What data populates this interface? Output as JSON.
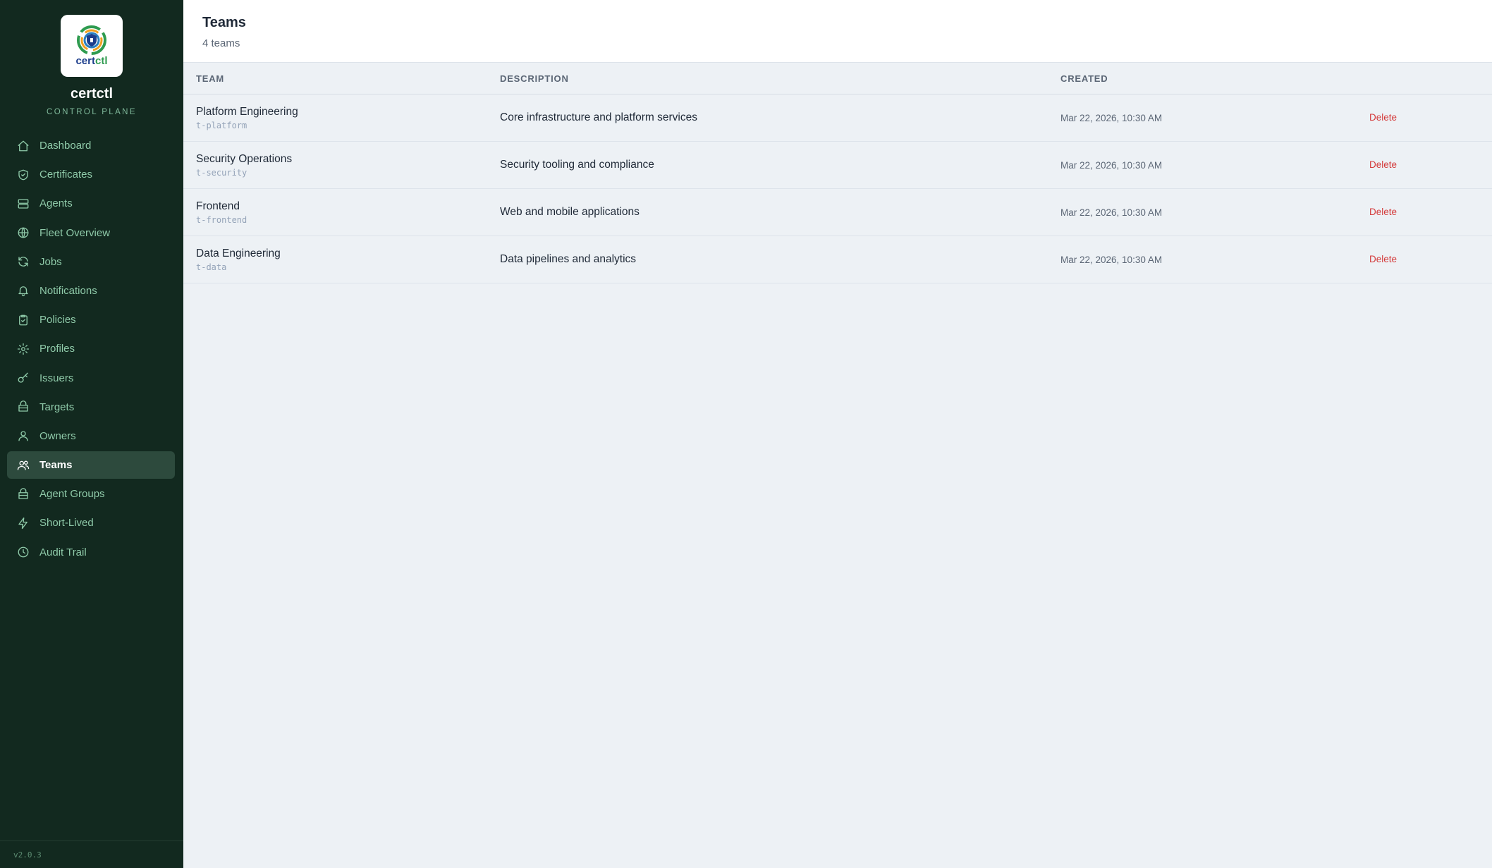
{
  "sidebar": {
    "logo_text_cert": "cert",
    "logo_text_ctl": "ctl",
    "brand_name": "certctl",
    "brand_subtitle": "CONTROL PLANE",
    "items": [
      {
        "label": "Dashboard",
        "icon": "home-icon"
      },
      {
        "label": "Certificates",
        "icon": "shield-icon"
      },
      {
        "label": "Agents",
        "icon": "server-icon"
      },
      {
        "label": "Fleet Overview",
        "icon": "globe-icon"
      },
      {
        "label": "Jobs",
        "icon": "refresh-icon"
      },
      {
        "label": "Notifications",
        "icon": "bell-icon"
      },
      {
        "label": "Policies",
        "icon": "clipboard-check-icon"
      },
      {
        "label": "Profiles",
        "icon": "gear-icon"
      },
      {
        "label": "Issuers",
        "icon": "key-icon"
      },
      {
        "label": "Targets",
        "icon": "box-icon"
      },
      {
        "label": "Owners",
        "icon": "user-icon"
      },
      {
        "label": "Teams",
        "icon": "users-icon",
        "active": true
      },
      {
        "label": "Agent Groups",
        "icon": "box-icon"
      },
      {
        "label": "Short-Lived",
        "icon": "bolt-icon"
      },
      {
        "label": "Audit Trail",
        "icon": "clock-icon"
      }
    ],
    "version": "v2.0.3"
  },
  "header": {
    "title": "Teams",
    "count": "4 teams"
  },
  "table": {
    "columns": [
      "TEAM",
      "DESCRIPTION",
      "CREATED",
      ""
    ],
    "rows": [
      {
        "name": "Platform Engineering",
        "id": "t-platform",
        "description": "Core infrastructure and platform services",
        "created": "Mar 22, 2026, 10:30 AM",
        "action": "Delete"
      },
      {
        "name": "Security Operations",
        "id": "t-security",
        "description": "Security tooling and compliance",
        "created": "Mar 22, 2026, 10:30 AM",
        "action": "Delete"
      },
      {
        "name": "Frontend",
        "id": "t-frontend",
        "description": "Web and mobile applications",
        "created": "Mar 22, 2026, 10:30 AM",
        "action": "Delete"
      },
      {
        "name": "Data Engineering",
        "id": "t-data",
        "description": "Data pipelines and analytics",
        "created": "Mar 22, 2026, 10:30 AM",
        "action": "Delete"
      }
    ]
  },
  "colors": {
    "sidebar_bg": "#12291f",
    "nav_text": "#8fcaa9",
    "active_bg": "#2d4a3d",
    "delete": "#d43a3a"
  }
}
